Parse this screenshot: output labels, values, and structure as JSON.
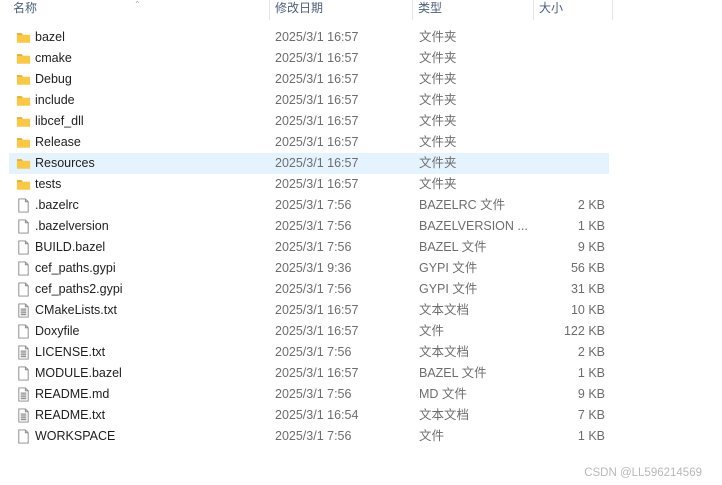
{
  "columns": {
    "name": "名称",
    "date": "修改日期",
    "type": "类型",
    "size": "大小"
  },
  "files": [
    {
      "name": "bazel",
      "date": "2025/3/1 16:57",
      "type": "文件夹",
      "size": "",
      "icon": "folder-icon"
    },
    {
      "name": "cmake",
      "date": "2025/3/1 16:57",
      "type": "文件夹",
      "size": "",
      "icon": "folder-icon"
    },
    {
      "name": "Debug",
      "date": "2025/3/1 16:57",
      "type": "文件夹",
      "size": "",
      "icon": "folder-icon"
    },
    {
      "name": "include",
      "date": "2025/3/1 16:57",
      "type": "文件夹",
      "size": "",
      "icon": "folder-icon"
    },
    {
      "name": "libcef_dll",
      "date": "2025/3/1 16:57",
      "type": "文件夹",
      "size": "",
      "icon": "folder-icon"
    },
    {
      "name": "Release",
      "date": "2025/3/1 16:57",
      "type": "文件夹",
      "size": "",
      "icon": "folder-icon"
    },
    {
      "name": "Resources",
      "date": "2025/3/1 16:57",
      "type": "文件夹",
      "size": "",
      "icon": "folder-icon",
      "hover": true
    },
    {
      "name": "tests",
      "date": "2025/3/1 16:57",
      "type": "文件夹",
      "size": "",
      "icon": "folder-icon"
    },
    {
      "name": ".bazelrc",
      "date": "2025/3/1 7:56",
      "type": "BAZELRC 文件",
      "size": "2 KB",
      "icon": "file-icon"
    },
    {
      "name": ".bazelversion",
      "date": "2025/3/1 7:56",
      "type": "BAZELVERSION ...",
      "size": "1 KB",
      "icon": "file-icon"
    },
    {
      "name": "BUILD.bazel",
      "date": "2025/3/1 7:56",
      "type": "BAZEL 文件",
      "size": "9 KB",
      "icon": "file-icon"
    },
    {
      "name": "cef_paths.gypi",
      "date": "2025/3/1 9:36",
      "type": "GYPI 文件",
      "size": "56 KB",
      "icon": "file-icon"
    },
    {
      "name": "cef_paths2.gypi",
      "date": "2025/3/1 7:56",
      "type": "GYPI 文件",
      "size": "31 KB",
      "icon": "file-icon"
    },
    {
      "name": "CMakeLists.txt",
      "date": "2025/3/1 16:57",
      "type": "文本文档",
      "size": "10 KB",
      "icon": "text-file-icon"
    },
    {
      "name": "Doxyfile",
      "date": "2025/3/1 16:57",
      "type": "文件",
      "size": "122 KB",
      "icon": "file-icon"
    },
    {
      "name": "LICENSE.txt",
      "date": "2025/3/1 7:56",
      "type": "文本文档",
      "size": "2 KB",
      "icon": "text-file-icon"
    },
    {
      "name": "MODULE.bazel",
      "date": "2025/3/1 16:57",
      "type": "BAZEL 文件",
      "size": "1 KB",
      "icon": "file-icon"
    },
    {
      "name": "README.md",
      "date": "2025/3/1 7:56",
      "type": "MD 文件",
      "size": "9 KB",
      "icon": "text-file-icon"
    },
    {
      "name": "README.txt",
      "date": "2025/3/1 16:54",
      "type": "文本文档",
      "size": "7 KB",
      "icon": "text-file-icon"
    },
    {
      "name": "WORKSPACE",
      "date": "2025/3/1 7:56",
      "type": "文件",
      "size": "1 KB",
      "icon": "file-icon"
    }
  ],
  "watermark": "CSDN @LL596214569",
  "colors": {
    "folder": "#f8c846",
    "hover_row": "#e5f3ff",
    "header_text": "#4c607a"
  }
}
